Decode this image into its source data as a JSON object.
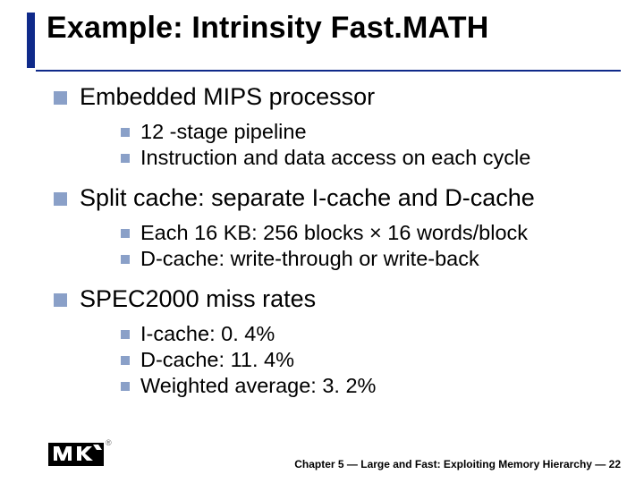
{
  "title": "Example: Intrinsity Fast.MATH",
  "bullets": [
    {
      "text": "Embedded MIPS processor",
      "sub": [
        "12 -stage pipeline",
        "Instruction and data access on each cycle"
      ]
    },
    {
      "text": "Split cache: separate I-cache and D-cache",
      "sub": [
        "Each 16 KB: 256 blocks × 16 words/block",
        "D-cache: write-through or write-back"
      ]
    },
    {
      "text": "SPEC2000 miss rates",
      "sub": [
        "I-cache: 0. 4%",
        "D-cache: 11. 4%",
        "Weighted average: 3. 2%"
      ]
    }
  ],
  "footer": "Chapter 5 — Large and Fast: Exploiting Memory Hierarchy — 22"
}
